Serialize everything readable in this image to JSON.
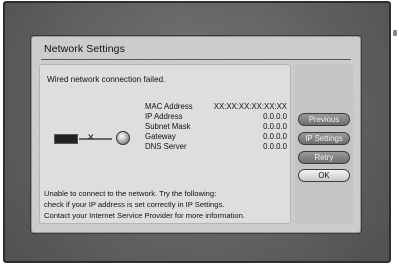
{
  "dialog": {
    "title": "Network Settings",
    "status_message": "Wired network connection failed."
  },
  "network_info": [
    {
      "label": "MAC Address",
      "value": "XX:XX:XX:XX:XX:XX"
    },
    {
      "label": "IP Address",
      "value": "0.0.0.0"
    },
    {
      "label": "Subnet Mask",
      "value": "0.0.0.0"
    },
    {
      "label": "Gateway",
      "value": "0.0.0.0"
    },
    {
      "label": "DNS Server",
      "value": "0.0.0.0"
    }
  ],
  "help_lines": [
    "Unable to connect to the network. Try the following:",
    "check if your IP address is set correctly in IP Settings.",
    "Contact your Internet Service Provider for more information."
  ],
  "buttons": {
    "previous": "Previous",
    "ip_settings": "IP Settings",
    "retry": "Retry",
    "ok": "OK"
  },
  "icons": {
    "device": "tv-icon",
    "link": "broken-cable-icon",
    "internet": "globe-icon"
  }
}
